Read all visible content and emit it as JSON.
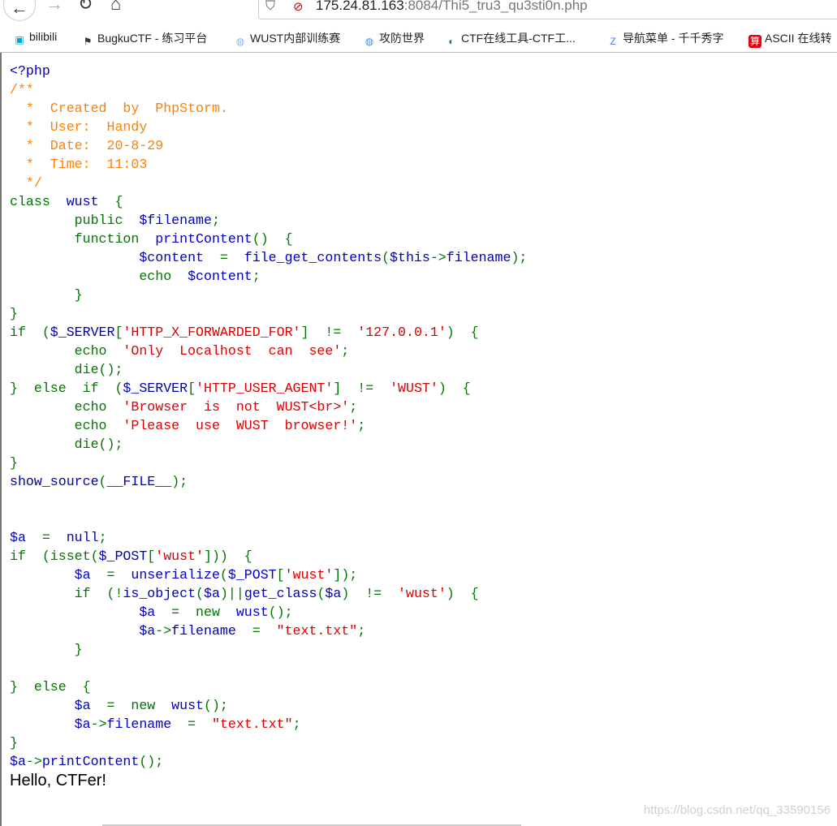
{
  "browser": {
    "url_host": "175.24.81.163",
    "url_rest": ":8084/Thi5_tru3_qu3sti0n.php",
    "icons": [
      "back-icon",
      "forward-icon",
      "reload-icon",
      "home-icon",
      "shield-icon",
      "insecure-lock-icon"
    ]
  },
  "bookmarks": [
    {
      "label": "bilibili",
      "icon": "bilibili-icon",
      "color": "#00a1d6"
    },
    {
      "label": "BugkuCTF - 练习平台",
      "icon": "flag-icon",
      "color": "#333333"
    },
    {
      "label": "WUST内部训练赛",
      "icon": "globe-icon",
      "color": "#8ab4f8"
    },
    {
      "label": "攻防世界",
      "icon": "globe-icon",
      "color": "#3a8ee6"
    },
    {
      "label": "CTF在线工具-CTF工...",
      "icon": "ctf-tools-icon",
      "color": "#1a7f6e"
    },
    {
      "label": "导航菜单 - 千千秀字",
      "icon": "z-logo-icon",
      "color": "#4a7cf7"
    },
    {
      "label": "ASCII 在线转",
      "icon": "calc-icon",
      "color": "#e60012"
    }
  ],
  "colors": {
    "keyword": "#007700",
    "default": "#0000BB",
    "string": "#DD0000",
    "comment": "#FF8000"
  },
  "code": {
    "lines": [
      [
        [
          "d",
          "<?php"
        ]
      ],
      [
        [
          "c",
          "/**"
        ]
      ],
      [
        [
          "c",
          "  *  Created  by  PhpStorm."
        ]
      ],
      [
        [
          "c",
          "  *  User:  Handy"
        ]
      ],
      [
        [
          "c",
          "  *  Date:  20-8-29"
        ]
      ],
      [
        [
          "c",
          "  *  Time:  11:03"
        ]
      ],
      [
        [
          "c",
          "  */"
        ]
      ],
      [
        [
          "k",
          "class  "
        ],
        [
          "d",
          "wust  "
        ],
        [
          "k",
          "{"
        ]
      ],
      [
        [
          "k",
          "        public  "
        ],
        [
          "d",
          "$filename"
        ],
        [
          "k",
          ";"
        ]
      ],
      [
        [
          "k",
          "        function  "
        ],
        [
          "d",
          "printContent"
        ],
        [
          "k",
          "()  {"
        ]
      ],
      [
        [
          "d",
          "                $content  "
        ],
        [
          "k",
          "=  "
        ],
        [
          "d",
          "file_get_contents"
        ],
        [
          "k",
          "("
        ],
        [
          "d",
          "$this"
        ],
        [
          "k",
          "->"
        ],
        [
          "d",
          "filename"
        ],
        [
          "k",
          ");"
        ]
      ],
      [
        [
          "k",
          "                echo  "
        ],
        [
          "d",
          "$content"
        ],
        [
          "k",
          ";"
        ]
      ],
      [
        [
          "k",
          "        }"
        ]
      ],
      [
        [
          "k",
          "}"
        ]
      ],
      [
        [
          "k",
          "if  ("
        ],
        [
          "d",
          "$_SERVER"
        ],
        [
          "k",
          "["
        ],
        [
          "s",
          "'HTTP_X_FORWARDED_FOR'"
        ],
        [
          "k",
          "]  !=  "
        ],
        [
          "s",
          "'127.0.0.1'"
        ],
        [
          "k",
          ")  {"
        ]
      ],
      [
        [
          "k",
          "        echo  "
        ],
        [
          "s",
          "'Only  Localhost  can  see'"
        ],
        [
          "k",
          ";"
        ]
      ],
      [
        [
          "k",
          "        die();"
        ]
      ],
      [
        [
          "k",
          "}  else  if  ("
        ],
        [
          "d",
          "$_SERVER"
        ],
        [
          "k",
          "["
        ],
        [
          "s",
          "'HTTP_USER_AGENT'"
        ],
        [
          "k",
          "]  !=  "
        ],
        [
          "s",
          "'WUST'"
        ],
        [
          "k",
          ")  {"
        ]
      ],
      [
        [
          "k",
          "        echo  "
        ],
        [
          "s",
          "'Browser  is  not  WUST<br>'"
        ],
        [
          "k",
          ";"
        ]
      ],
      [
        [
          "k",
          "        echo  "
        ],
        [
          "s",
          "'Please  use  WUST  browser!'"
        ],
        [
          "k",
          ";"
        ]
      ],
      [
        [
          "k",
          "        die();"
        ]
      ],
      [
        [
          "k",
          "}"
        ]
      ],
      [
        [
          "d",
          "show_source"
        ],
        [
          "k",
          "("
        ],
        [
          "d",
          "__FILE__"
        ],
        [
          "k",
          ");"
        ]
      ],
      [],
      [],
      [
        [
          "d",
          "$a  "
        ],
        [
          "k",
          "=  "
        ],
        [
          "d",
          "null"
        ],
        [
          "k",
          ";"
        ]
      ],
      [
        [
          "k",
          "if  (isset("
        ],
        [
          "d",
          "$_POST"
        ],
        [
          "k",
          "["
        ],
        [
          "s",
          "'wust'"
        ],
        [
          "k",
          "]))  {"
        ]
      ],
      [
        [
          "d",
          "        $a  "
        ],
        [
          "k",
          "=  "
        ],
        [
          "d",
          "unserialize"
        ],
        [
          "k",
          "("
        ],
        [
          "d",
          "$_POST"
        ],
        [
          "k",
          "["
        ],
        [
          "s",
          "'wust'"
        ],
        [
          "k",
          "]);"
        ]
      ],
      [
        [
          "k",
          "        if  (!"
        ],
        [
          "d",
          "is_object"
        ],
        [
          "k",
          "("
        ],
        [
          "d",
          "$a"
        ],
        [
          "k",
          ")||"
        ],
        [
          "d",
          "get_class"
        ],
        [
          "k",
          "("
        ],
        [
          "d",
          "$a"
        ],
        [
          "k",
          ")  !=  "
        ],
        [
          "s",
          "'wust'"
        ],
        [
          "k",
          ")  {"
        ]
      ],
      [
        [
          "d",
          "                $a  "
        ],
        [
          "k",
          "=  new  "
        ],
        [
          "d",
          "wust"
        ],
        [
          "k",
          "();"
        ]
      ],
      [
        [
          "d",
          "                $a"
        ],
        [
          "k",
          "->"
        ],
        [
          "d",
          "filename  "
        ],
        [
          "k",
          "=  "
        ],
        [
          "s",
          "\"text.txt\""
        ],
        [
          "k",
          ";"
        ]
      ],
      [
        [
          "k",
          "        }"
        ]
      ],
      [],
      [
        [
          "k",
          "}  else  {"
        ]
      ],
      [
        [
          "d",
          "        $a  "
        ],
        [
          "k",
          "=  new  "
        ],
        [
          "d",
          "wust"
        ],
        [
          "k",
          "();"
        ]
      ],
      [
        [
          "d",
          "        $a"
        ],
        [
          "k",
          "->"
        ],
        [
          "d",
          "filename  "
        ],
        [
          "k",
          "=  "
        ],
        [
          "s",
          "\"text.txt\""
        ],
        [
          "k",
          ";"
        ]
      ],
      [
        [
          "k",
          "}"
        ]
      ],
      [
        [
          "d",
          "$a"
        ],
        [
          "k",
          "->"
        ],
        [
          "d",
          "printContent"
        ],
        [
          "k",
          "();"
        ]
      ]
    ]
  },
  "output": "Hello, CTFer!",
  "watermark": "https://blog.csdn.net/qq_33590156"
}
